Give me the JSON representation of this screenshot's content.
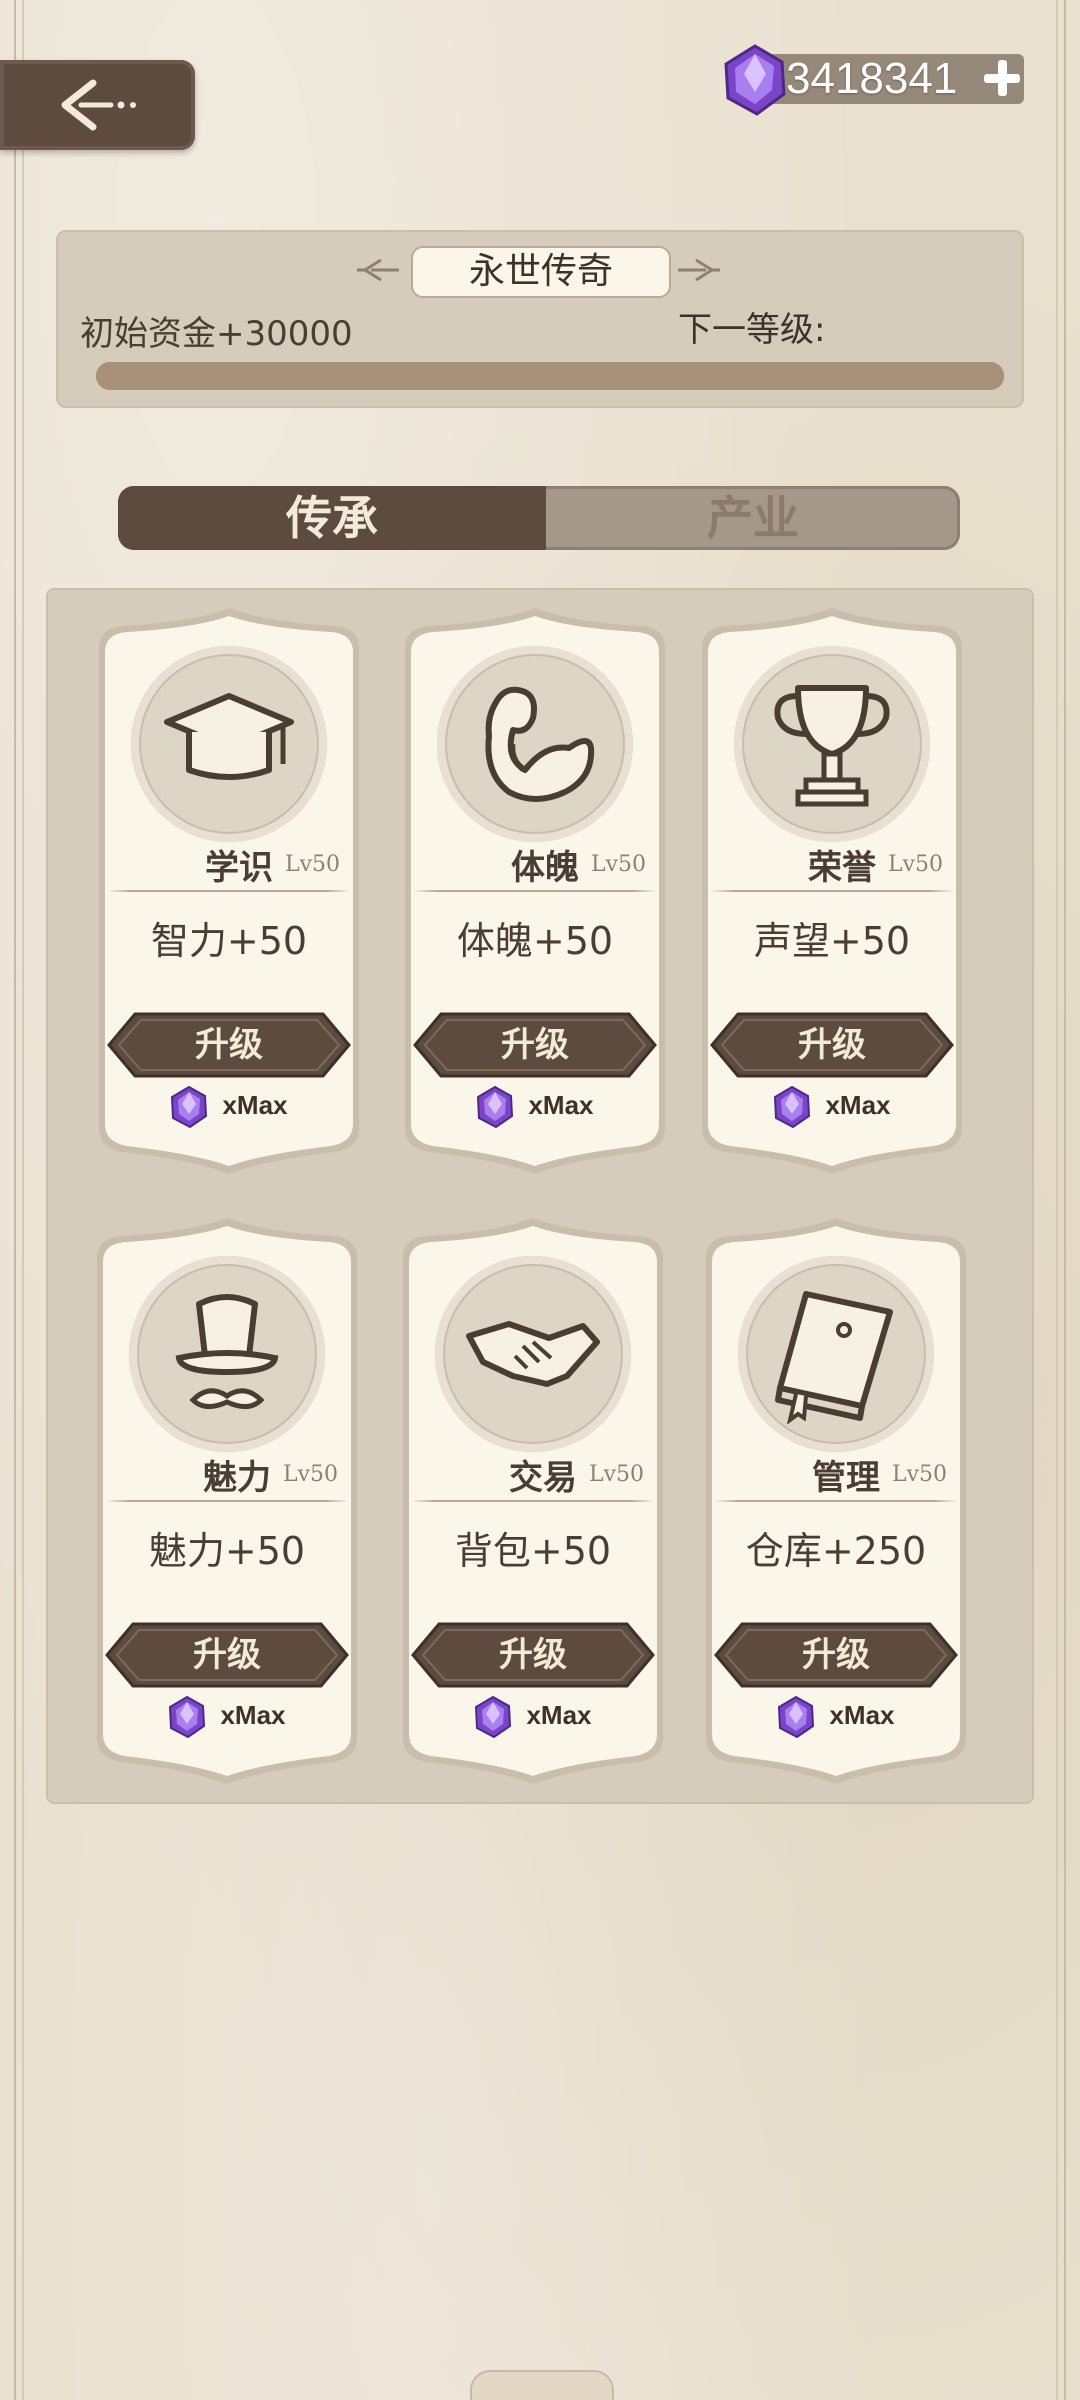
{
  "header": {
    "currency_amount": "3418341"
  },
  "level_panel": {
    "title": "永世传奇",
    "start_fund": "初始资金+30000",
    "next_level_label": "下一等级:",
    "progress": 1.0
  },
  "tabs": [
    {
      "label": "传承",
      "active": true
    },
    {
      "label": "产业",
      "active": false
    }
  ],
  "cards": [
    {
      "name": "学识",
      "level": "Lv50",
      "effect": "智力+50",
      "button": "升级",
      "cost": "xMax",
      "icon": "graduation-cap-icon"
    },
    {
      "name": "体魄",
      "level": "Lv50",
      "effect": "体魄+50",
      "button": "升级",
      "cost": "xMax",
      "icon": "flexed-arm-icon"
    },
    {
      "name": "荣誉",
      "level": "Lv50",
      "effect": "声望+50",
      "button": "升级",
      "cost": "xMax",
      "icon": "trophy-icon"
    },
    {
      "name": "魅力",
      "level": "Lv50",
      "effect": "魅力+50",
      "button": "升级",
      "cost": "xMax",
      "icon": "top-hat-icon"
    },
    {
      "name": "交易",
      "level": "Lv50",
      "effect": "背包+50",
      "button": "升级",
      "cost": "xMax",
      "icon": "handshake-icon"
    },
    {
      "name": "管理",
      "level": "Lv50",
      "effect": "仓库+250",
      "button": "升级",
      "cost": "xMax",
      "icon": "book-icon"
    }
  ],
  "colors": {
    "dark_brown": "#5c4b3e",
    "panel": "#d6ccbb",
    "card": "#fbf6ea",
    "gem_purple": "#8e5fd6"
  }
}
